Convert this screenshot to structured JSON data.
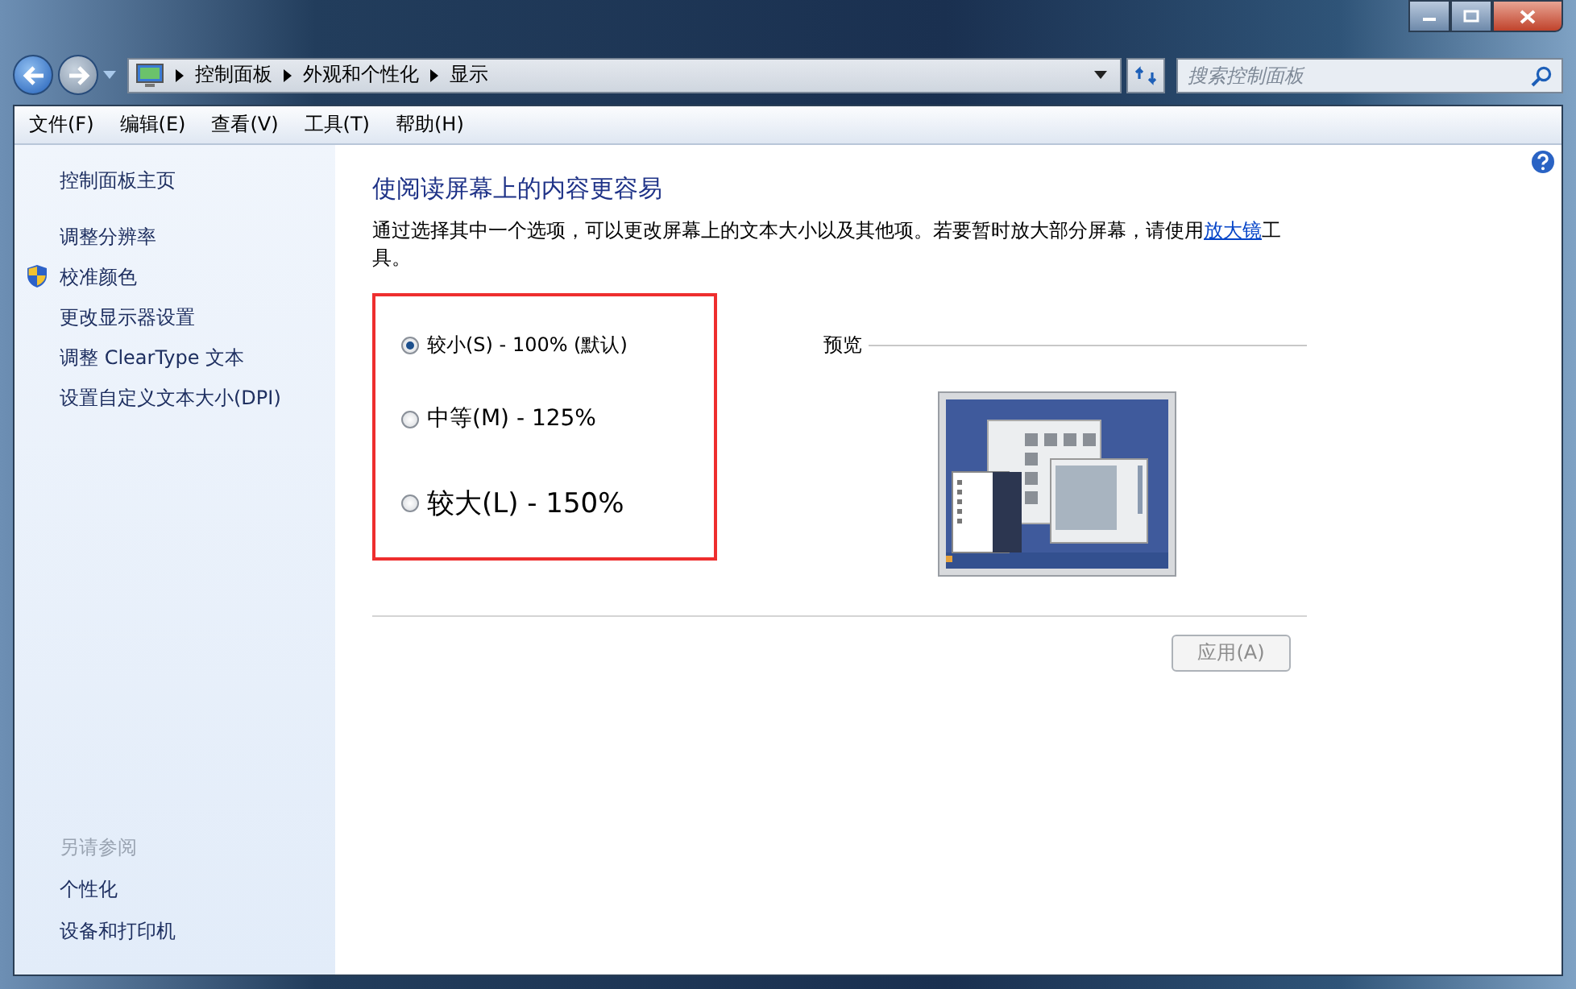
{
  "address_bar": {
    "breadcrumbs": [
      "控制面板",
      "外观和个性化",
      "显示"
    ]
  },
  "search": {
    "placeholder": "搜索控制面板"
  },
  "menu": [
    "文件(F)",
    "编辑(E)",
    "查看(V)",
    "工具(T)",
    "帮助(H)"
  ],
  "sidebar": {
    "items": [
      {
        "label": "控制面板主页",
        "kind": "home"
      },
      {
        "label": "调整分辨率",
        "kind": "link"
      },
      {
        "label": "校准颜色",
        "kind": "shield"
      },
      {
        "label": "更改显示器设置",
        "kind": "link"
      },
      {
        "label": "调整 ClearType 文本",
        "kind": "link"
      },
      {
        "label": "设置自定义文本大小(DPI)",
        "kind": "link"
      }
    ],
    "see_also": {
      "heading": "另请参阅",
      "items": [
        "个性化",
        "设备和打印机"
      ]
    }
  },
  "main": {
    "title": "使阅读屏幕上的内容更容易",
    "description_before": "通过选择其中一个选项，可以更改屏幕上的文本大小以及其他项。若要暂时放大部分屏幕，请使用",
    "description_link": "放大镜",
    "description_after": "工具。",
    "options": [
      {
        "label": "较小(S) - 100% (默认)",
        "kind": "small",
        "selected": true
      },
      {
        "label": "中等(M) - 125%",
        "kind": "medium",
        "selected": false
      },
      {
        "label": "较大(L) - 150%",
        "kind": "large",
        "selected": false
      }
    ],
    "preview_label": "预览",
    "apply_button": {
      "label": "应用(A)",
      "disabled": true
    }
  }
}
